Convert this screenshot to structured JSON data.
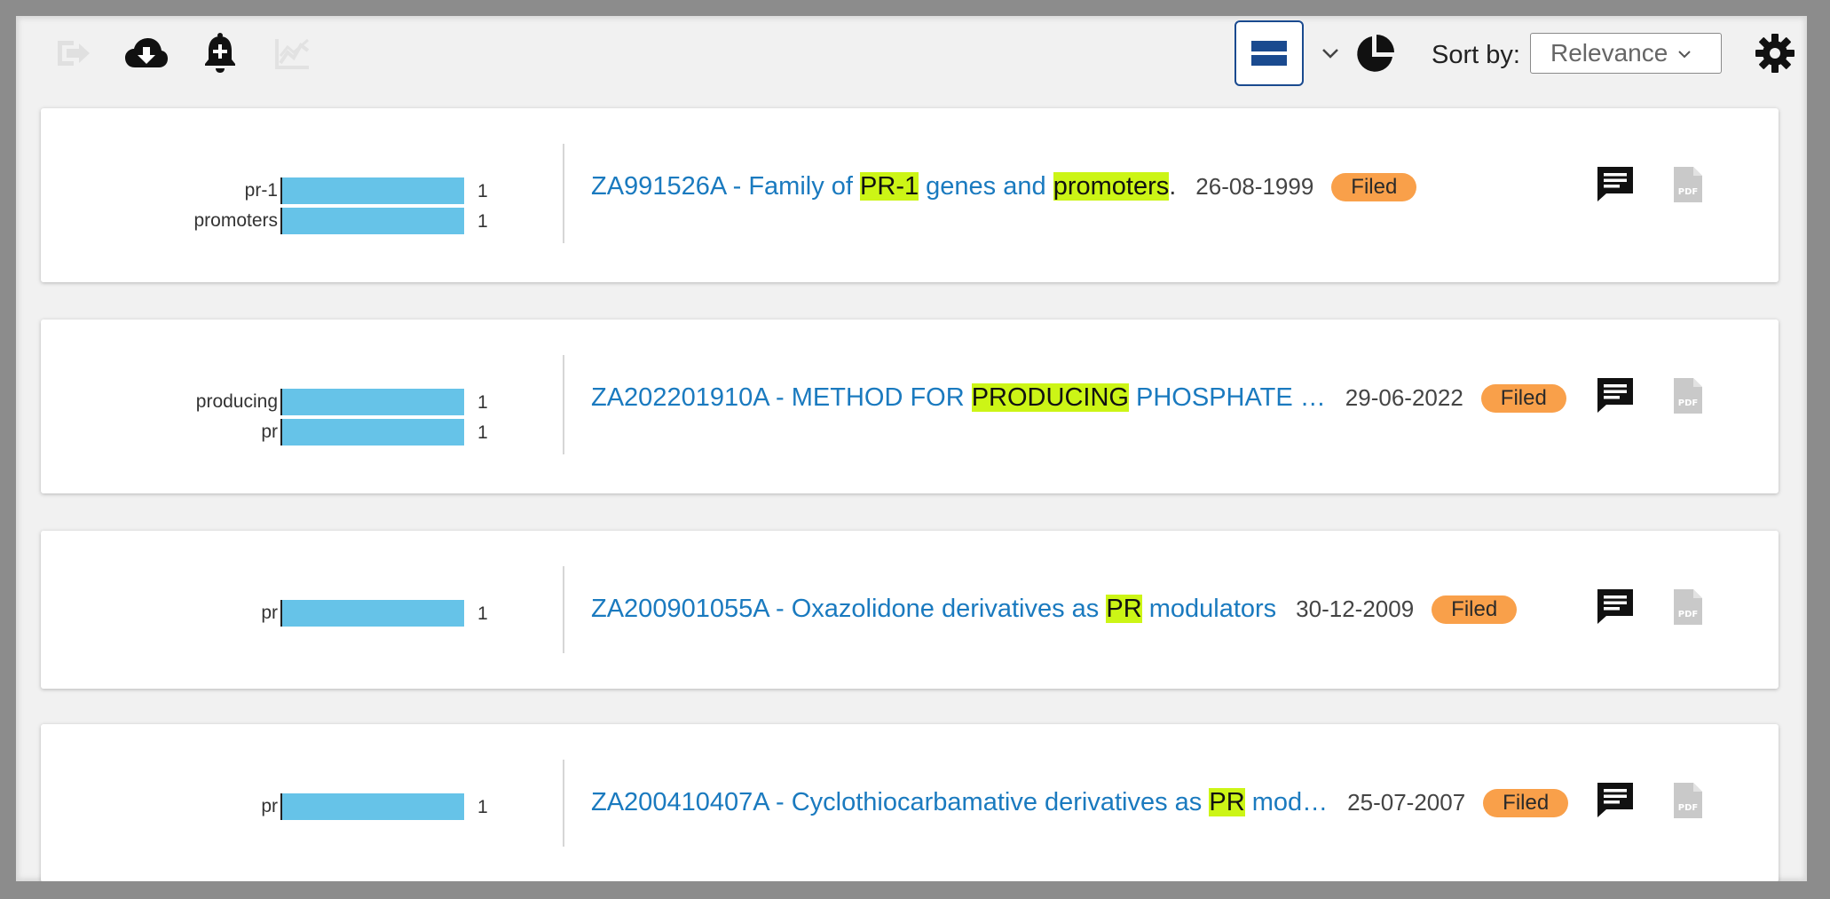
{
  "toolbar": {
    "icons": [
      "export-icon",
      "cloud-download-icon",
      "add-alert-icon",
      "chart-icon"
    ],
    "view_icon": "list-view-icon",
    "dropdown_icon": "chevron-down-icon",
    "pie_icon": "pie-chart-icon",
    "sort_label": "Sort by:",
    "sort_value": "Relevance",
    "settings_icon": "gear-icon"
  },
  "colors": {
    "link": "#1a7abf",
    "highlight": "#ccf516",
    "bar": "#66c3e8",
    "status": "#f9a04a",
    "accent": "#1a4a8f"
  },
  "results": [
    {
      "bars": [
        {
          "label": "pr-1",
          "value": "1"
        },
        {
          "label": "promoters",
          "value": "1"
        }
      ],
      "title_parts": [
        {
          "t": "ZA991526A - Family of ",
          "hl": false
        },
        {
          "t": "PR-1",
          "hl": true
        },
        {
          "t": " genes and ",
          "hl": false
        },
        {
          "t": "promoters",
          "hl": true
        },
        {
          "t": ".",
          "hl": false
        }
      ],
      "date": "26-08-1999",
      "status": "Filed"
    },
    {
      "bars": [
        {
          "label": "producing",
          "value": "1"
        },
        {
          "label": "pr",
          "value": "1"
        }
      ],
      "title_parts": [
        {
          "t": "ZA202201910A - METHOD FOR ",
          "hl": false
        },
        {
          "t": "PRODUCING",
          "hl": true
        },
        {
          "t": " PHOSPHATE …",
          "hl": false
        }
      ],
      "date": "29-06-2022",
      "status": "Filed"
    },
    {
      "bars": [
        {
          "label": "pr",
          "value": "1"
        }
      ],
      "title_parts": [
        {
          "t": "ZA200901055A - Oxazolidone derivatives as ",
          "hl": false
        },
        {
          "t": "PR",
          "hl": true
        },
        {
          "t": " modulators",
          "hl": false
        }
      ],
      "date": "30-12-2009",
      "status": "Filed"
    },
    {
      "bars": [
        {
          "label": "pr",
          "value": "1"
        }
      ],
      "title_parts": [
        {
          "t": "ZA200410407A - Cyclothiocarbamative derivatives as ",
          "hl": false
        },
        {
          "t": "PR",
          "hl": true
        },
        {
          "t": " mod…",
          "hl": false
        }
      ],
      "date": "25-07-2007",
      "status": "Filed"
    }
  ]
}
